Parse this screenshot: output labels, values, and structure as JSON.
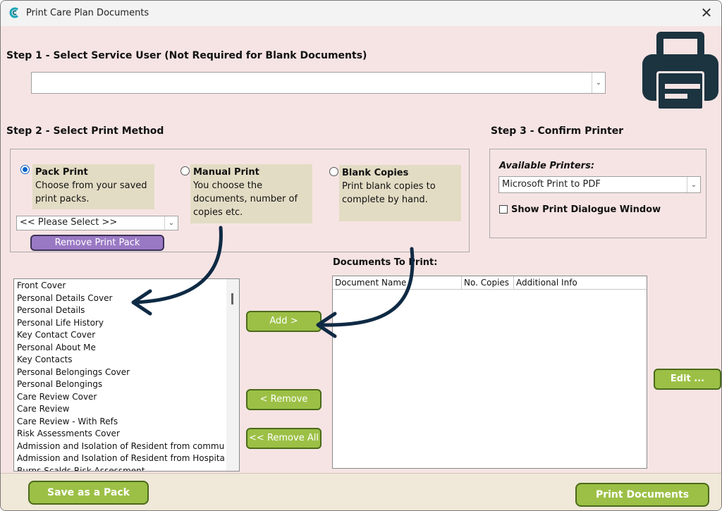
{
  "window": {
    "title": "Print Care Plan Documents",
    "close_symbol": "✕"
  },
  "step1": {
    "heading": "Step 1 - Select Service User (Not Required for Blank Documents)",
    "service_user_value": ""
  },
  "step2": {
    "heading": "Step 2 - Select Print Method",
    "options": [
      {
        "title": "Pack Print",
        "lines": [
          "Choose from your saved",
          "print packs."
        ],
        "selected": true
      },
      {
        "title": "Manual Print",
        "lines": [
          "You choose the",
          "documents, number of",
          "copies etc."
        ],
        "selected": false
      },
      {
        "title": "Blank Copies",
        "lines": [
          "Print blank copies to",
          "complete by hand."
        ],
        "selected": false
      }
    ],
    "pack_select_value": "<< Please Select >>",
    "remove_pack_label": "Remove Print Pack"
  },
  "step3": {
    "heading": "Step 3 - Confirm Printer",
    "available_label": "Available Printers:",
    "printer_value": "Microsoft Print to PDF",
    "dialog_checkbox_label": "Show Print Dialogue Window",
    "dialog_checked": false
  },
  "documents": [
    "Front Cover",
    "Personal Details Cover",
    "Personal Details",
    "Personal Life History",
    "Key Contact Cover",
    "Personal About Me",
    "Key Contacts",
    "Personal Belongings Cover",
    "Personal Belongings",
    "Care Review Cover",
    "Care Review",
    "Care Review - With Refs",
    "Risk Assessments Cover",
    "Admission and Isolation of Resident from commu",
    "Admission and Isolation of Resident from Hospita",
    "Burns Scalds Risk Assessment"
  ],
  "buttons": {
    "add": "Add >",
    "remove": "< Remove",
    "remove_all": "<< Remove All",
    "edit": "Edit ...",
    "save_pack": "Save as a Pack",
    "print": "Print Documents"
  },
  "print_list": {
    "heading": "Documents To Print:",
    "columns": [
      "Document Name",
      "No. Copies",
      "Additional Info"
    ],
    "rows": []
  },
  "colors": {
    "window_bg": "#f6e4e4",
    "green_button": "#9cc046",
    "purple_button": "#9a79c4",
    "description_bg": "#e3dcc4",
    "arrow": "#0f2a44"
  },
  "icons": {
    "app": "app-logo-icon",
    "printer": "printer-icon",
    "arrows": "curved-arrow-icon"
  }
}
